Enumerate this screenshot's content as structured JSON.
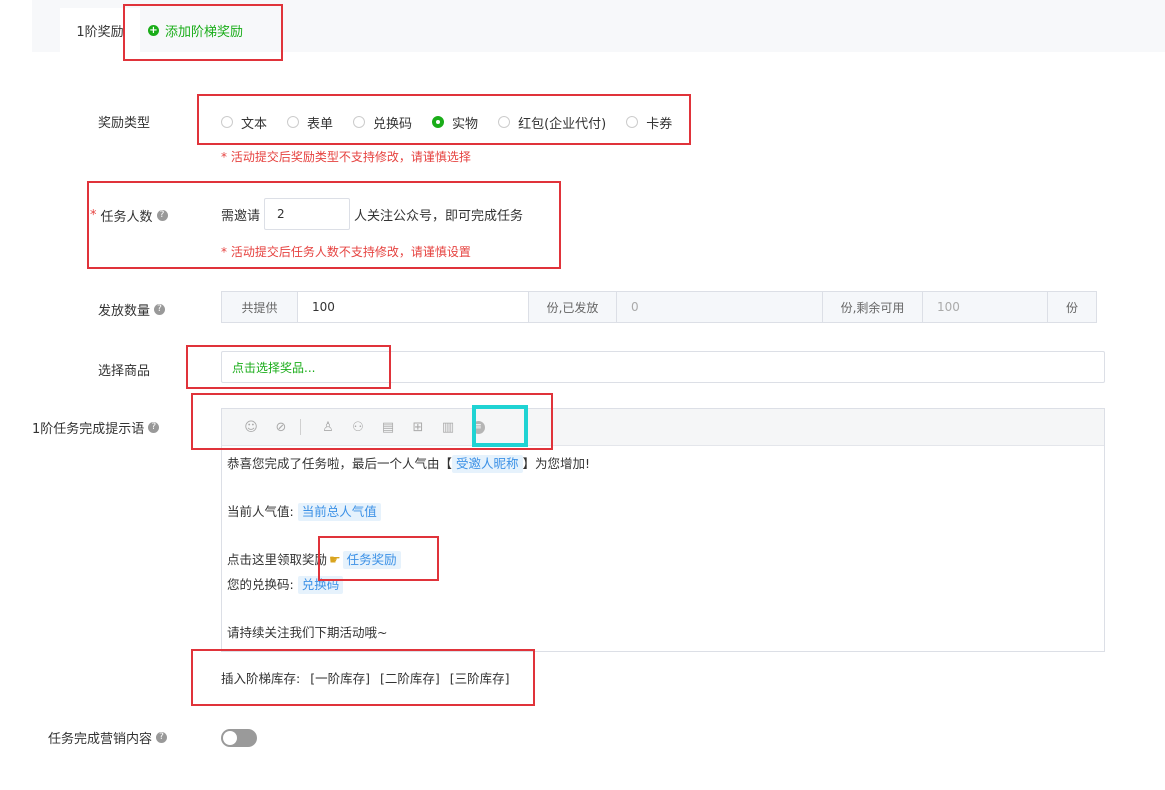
{
  "tabs": {
    "active_label": "1阶奖励",
    "add_label": "添加阶梯奖励"
  },
  "reward_type": {
    "label": "奖励类型",
    "options": [
      "文本",
      "表单",
      "兑换码",
      "实物",
      "红包(企业代付)",
      "卡券"
    ],
    "selected": "实物",
    "warning": "* 活动提交后奖励类型不支持修改，请谨慎选择"
  },
  "task_count": {
    "required_mark": "*",
    "label": "任务人数",
    "prefix": "需邀请",
    "value": "2",
    "suffix": "人关注公众号，即可完成任务",
    "warning": "* 活动提交后任务人数不支持修改，请谨慎设置"
  },
  "distribution": {
    "label": "发放数量",
    "total_prefix": "共提供",
    "total_value": "100",
    "issued_label": "份,已发放",
    "issued_value": "0",
    "remaining_label": "份,剩余可用",
    "remaining_value": "100",
    "unit": "份"
  },
  "product": {
    "label": "选择商品",
    "placeholder": "点击选择奖品..."
  },
  "completion_message": {
    "label": "1阶任务完成提示语",
    "line1_pre": "恭喜您完成了任务啦，最后一个人气由【",
    "line1_tag": "受邀人昵称",
    "line1_post": "】为您增加!",
    "line2_pre": "当前人气值:",
    "line2_tag": "当前总人气值",
    "line3_pre": "点击这里领取奖励",
    "line3_tag": "任务奖励",
    "line4_pre": "您的兑换码:",
    "line4_tag": "兑换码",
    "line5": "请持续关注我们下期活动哦~"
  },
  "stock": {
    "prefix": "插入阶梯库存:",
    "items": [
      "[一阶库存]",
      "[二阶库存]",
      "[三阶库存]"
    ]
  },
  "marketing": {
    "label": "任务完成营销内容",
    "enabled": false
  },
  "colors": {
    "accent": "#1aad19",
    "warning": "#e64340",
    "tag_text": "#3c91e6",
    "annotation_red": "#e0333a",
    "annotation_cyan": "#1fd3d3"
  },
  "icons": {
    "toolbar": [
      "emoji-icon",
      "link-icon",
      "user-icon",
      "users-icon",
      "document-icon",
      "gift-icon",
      "chart-icon",
      "exchange-code-icon"
    ],
    "help": "help-circle-icon",
    "pointer": "pointing-hand-icon"
  }
}
